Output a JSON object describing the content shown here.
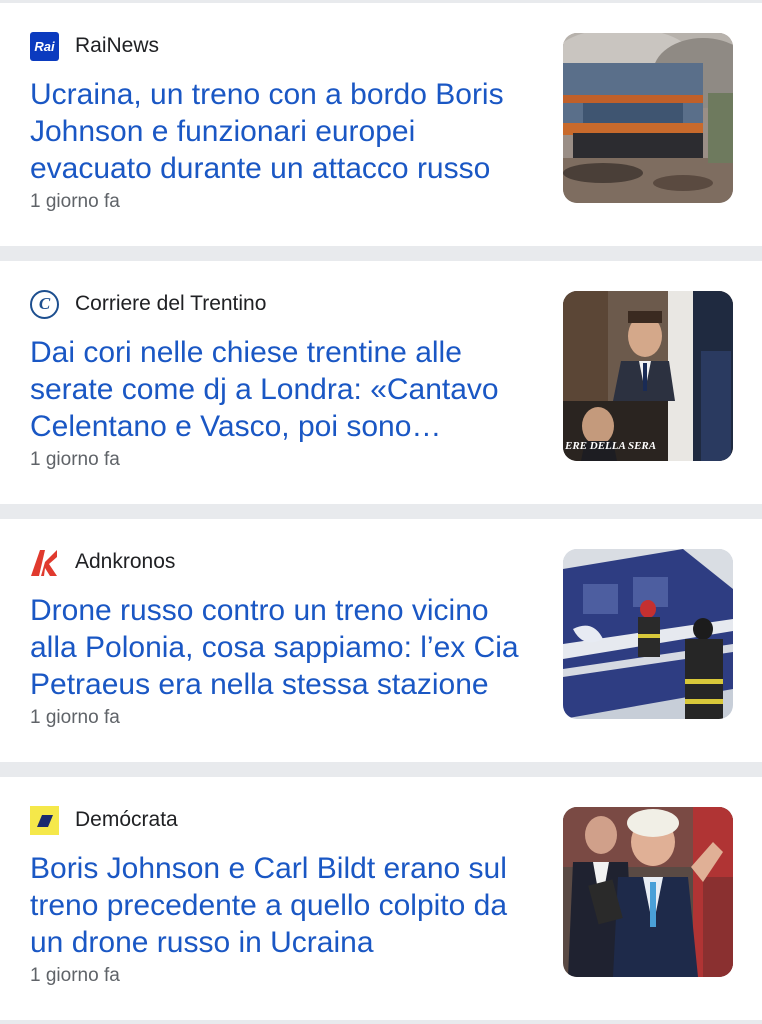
{
  "articles": [
    {
      "source": "RaiNews",
      "logo_icon": "rai-logo-icon",
      "logo_text": "Rai",
      "headline": "Ucraina, un treno con a bordo Boris Johnson e funzionari europei evacuato durante un attacco russo",
      "time": "1 giorno fa",
      "thumbnail": "burning-train-photo"
    },
    {
      "source": "Corriere del Trentino",
      "logo_icon": "corriere-logo-icon",
      "logo_text": "C",
      "headline": "Dai cori nelle chiese trentine alle serate come dj a Londra: «Cantavo Celentano e Vasco, poi sono…",
      "time": "1 giorno fa",
      "thumbnail": "man-in-suit-photo",
      "thumbnail_caption": "ERE DELLA SERA"
    },
    {
      "source": "Adnkronos",
      "logo_icon": "adnkronos-logo-icon",
      "headline": "Drone russo contro un treno vicino alla Polonia, cosa sappiamo: l’ex Cia Petraeus era nella stessa stazione",
      "time": "1 giorno fa",
      "thumbnail": "firefighter-train-photo"
    },
    {
      "source": "Demócrata",
      "logo_icon": "democrata-logo-icon",
      "headline": "Boris Johnson e Carl Bildt erano sul treno precedente a quello colpito da un drone russo in Ucraina",
      "time": "1 giorno fa",
      "thumbnail": "boris-johnson-photo"
    }
  ],
  "colors": {
    "headline": "#1a57c4",
    "separator": "#e8eaed",
    "rai_blue": "#0b3bbf",
    "adnkronos_red": "#e03a2e",
    "democrata_yellow": "#f5e84a"
  }
}
